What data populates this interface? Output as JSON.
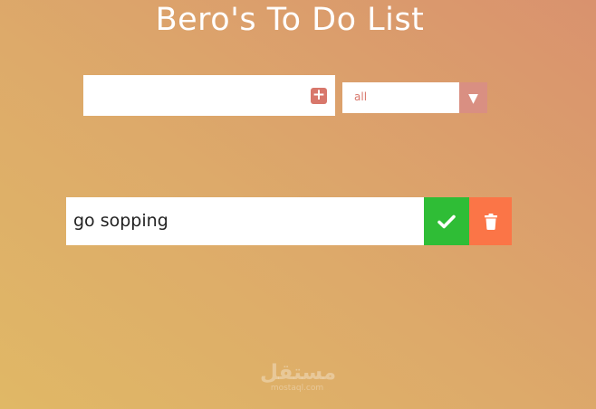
{
  "header": {
    "title": "Bero's To Do List"
  },
  "form": {
    "input_value": "",
    "add_icon": "plus-square-icon",
    "filter": {
      "selected": "all",
      "arrow_icon": "caret-down-icon"
    }
  },
  "todos": [
    {
      "text": "go sopping",
      "complete_icon": "check-icon",
      "delete_icon": "trash-icon"
    }
  ],
  "watermark": {
    "arabic": "مستقل",
    "latin": "mostaql.com"
  },
  "colors": {
    "accent": "#d8776b",
    "complete": "#2fbd36",
    "delete": "#fb7547",
    "background_start": "#e0b866",
    "background_end": "#d9926e"
  }
}
